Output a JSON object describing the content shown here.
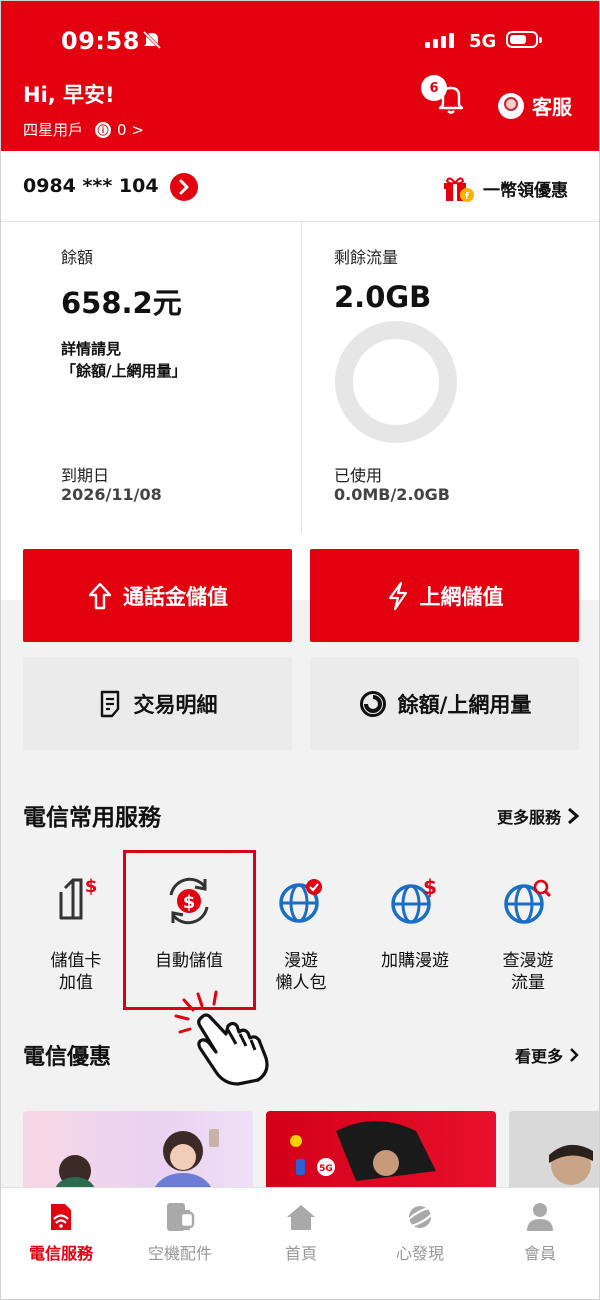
{
  "status_bar": {
    "time": "09:58",
    "network": "5G"
  },
  "header": {
    "greeting": "Hi, 早安!",
    "member_level": "四星用戶",
    "points": "0 >",
    "notification_count": "6",
    "service_label": "客服"
  },
  "account": {
    "phone": "0984 *** 104",
    "promo_label": "一幣領優惠"
  },
  "balance": {
    "label": "餘額",
    "amount": "658.2元",
    "note_line1": "詳情請見",
    "note_line2": "「餘額/上網用量」",
    "expiry_label": "到期日",
    "expiry_date": "2026/11/08"
  },
  "data_usage": {
    "label": "剩餘流量",
    "remaining": "2.0GB",
    "used_label": "已使用",
    "used_value": "0.0MB/2.0GB",
    "used_fraction": 0
  },
  "actions": {
    "topup_call": "通話金儲值",
    "topup_data": "上網儲值",
    "transactions": "交易明細",
    "usage": "餘額/上網用量"
  },
  "services": {
    "title": "電信常用服務",
    "more": "更多服務",
    "items": [
      {
        "line1": "儲值卡",
        "line2": "加值",
        "icon": "prepaid-card-icon"
      },
      {
        "line1": "自動儲值",
        "line2": "",
        "icon": "auto-topup-icon"
      },
      {
        "line1": "漫遊",
        "line2": "懶人包",
        "icon": "roaming-globe-check-icon"
      },
      {
        "line1": "加購漫遊",
        "line2": "",
        "icon": "roaming-globe-dollar-icon"
      },
      {
        "line1": "查漫遊",
        "line2": "流量",
        "icon": "roaming-globe-search-icon"
      }
    ]
  },
  "offers": {
    "title": "電信優惠",
    "more": "看更多"
  },
  "tabbar": {
    "items": [
      {
        "label": "電信服務",
        "icon": "sim-card-icon",
        "active": true
      },
      {
        "label": "空機配件",
        "icon": "phone-watch-icon",
        "active": false
      },
      {
        "label": "首頁",
        "icon": "home-icon",
        "active": false
      },
      {
        "label": "心發現",
        "icon": "planet-icon",
        "active": false
      },
      {
        "label": "會員",
        "icon": "person-icon",
        "active": false
      }
    ]
  },
  "colors": {
    "brand_red": "#e3000f",
    "bg_gray": "#f2f2f2",
    "button_gray": "#ebebeb"
  }
}
